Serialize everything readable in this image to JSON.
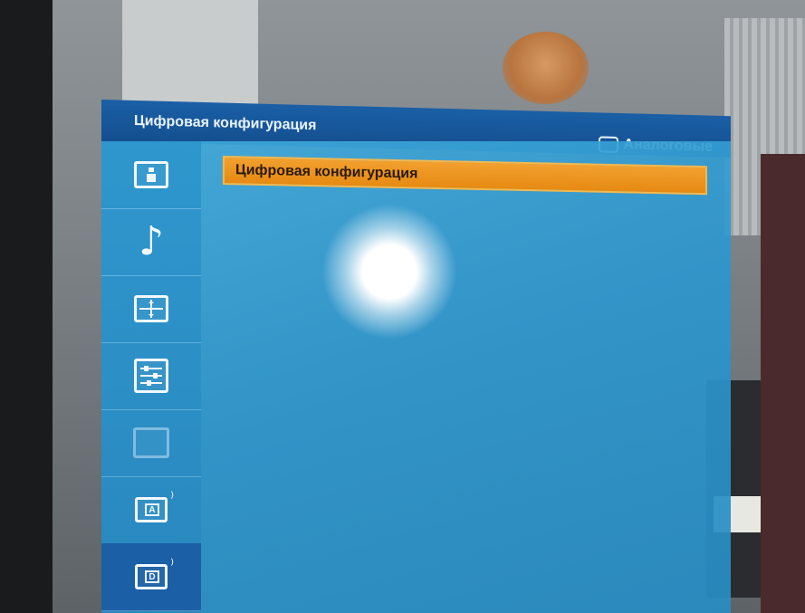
{
  "osd": {
    "title": "Цифровая конфигурация",
    "source_label": "Аналоговые"
  },
  "sidebar": {
    "items": [
      {
        "icon": "picture-icon",
        "active": false
      },
      {
        "icon": "music-note-icon",
        "active": false
      },
      {
        "icon": "screen-setup-icon",
        "active": false
      },
      {
        "icon": "tuning-icon",
        "active": false
      },
      {
        "icon": "monitor-icon",
        "active": false
      },
      {
        "icon": "analog-antenna-icon",
        "letter": "A",
        "active": false
      },
      {
        "icon": "digital-antenna-icon",
        "letter": "D",
        "active": true
      }
    ]
  },
  "menu": {
    "items": [
      {
        "label": "Цифровая конфигурация",
        "selected": true
      }
    ]
  },
  "colors": {
    "header": "#144f8f",
    "panel": "#2c96cd",
    "highlight": "#e68a12"
  }
}
